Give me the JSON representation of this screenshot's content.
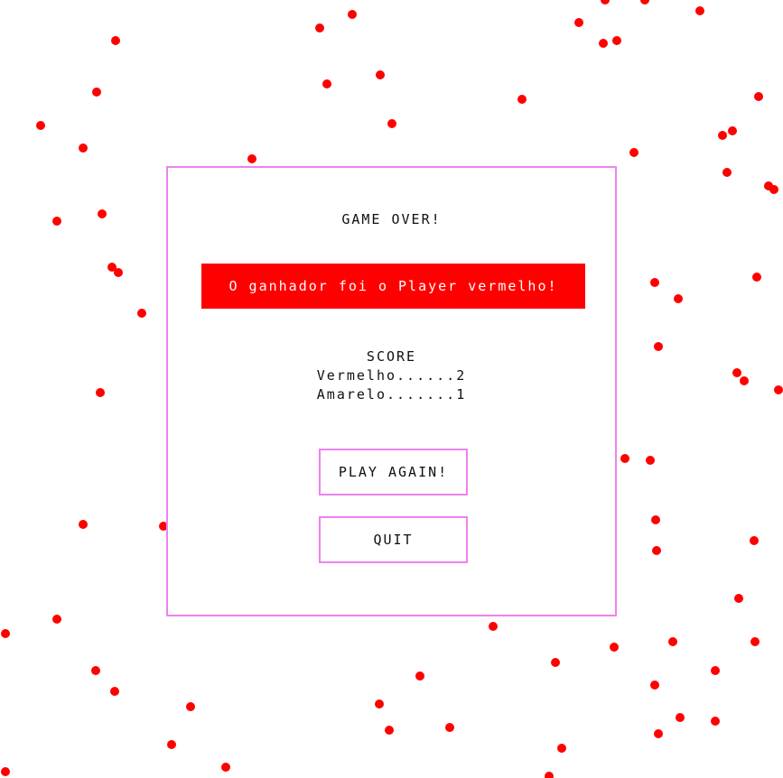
{
  "game_over": {
    "title": "GAME OVER!",
    "winner_message": "O ganhador foi o Player vermelho!",
    "score_heading": "SCORE",
    "score_lines": [
      "Vermelho......2",
      "Amarelo.......1"
    ],
    "buttons": {
      "play_again": "PLAY AGAIN!",
      "quit": "QUIT"
    }
  },
  "colors": {
    "dot": "#ff0000",
    "dialog_border": "#ee82ee",
    "winner_bg": "#ff0000",
    "winner_text": "#ffffff"
  }
}
